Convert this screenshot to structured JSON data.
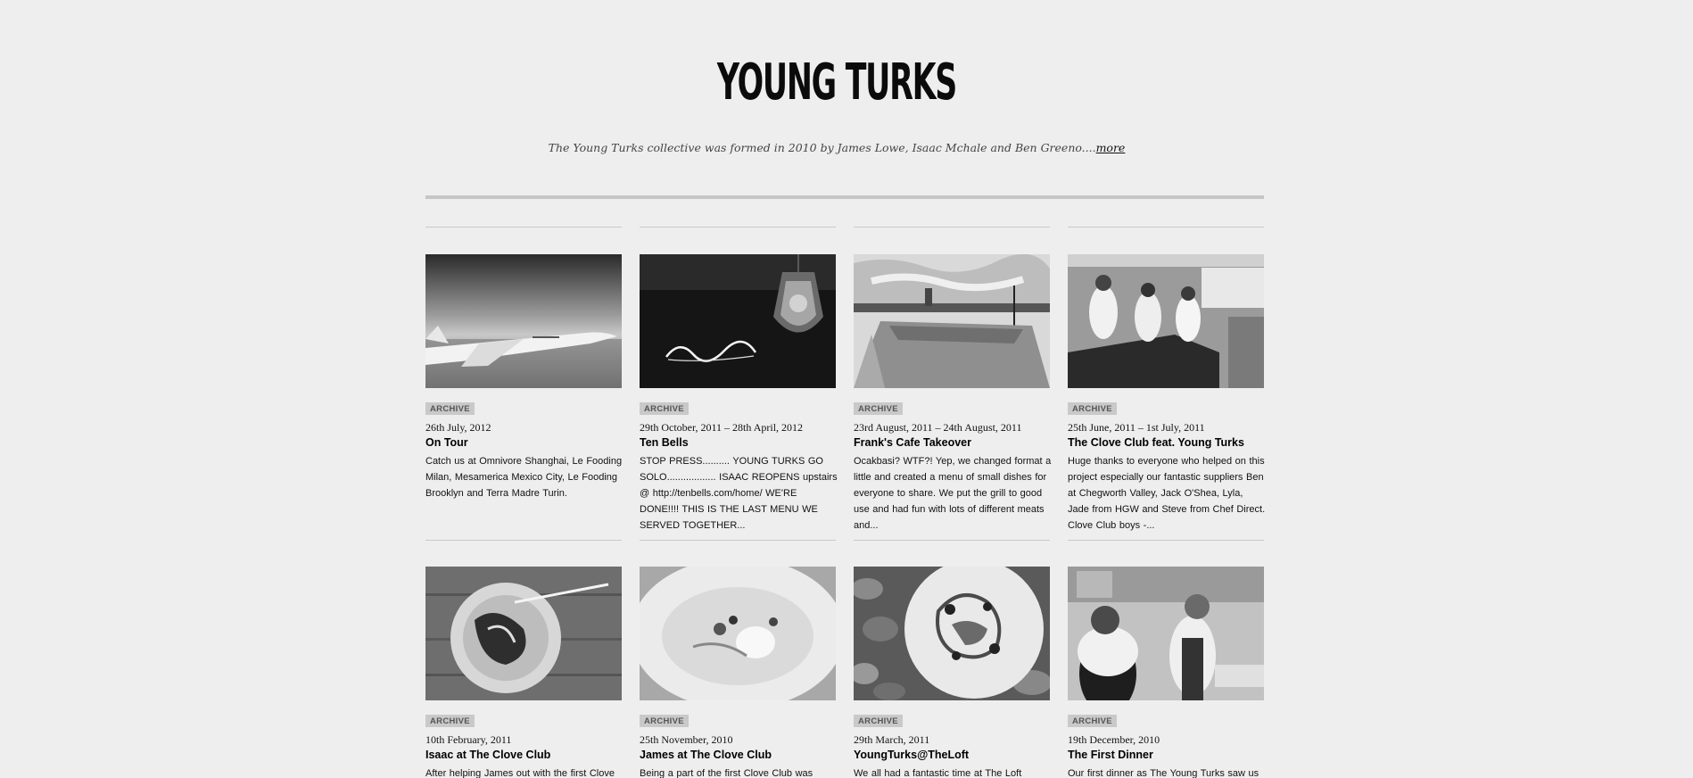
{
  "site": {
    "title": "YOUNG TURKS",
    "tagline": "The Young Turks collective was formed in 2010 by James Lowe, Isaac Mchale and Ben Greeno....",
    "more_link": "more"
  },
  "posts": [
    {
      "category": "ARCHIVE",
      "date": "26th July, 2012",
      "title": "On Tour",
      "excerpt": "Catch us at Omnivore Shanghai, Le Fooding Milan, Mesamerica Mexico City, Le Fooding Brooklyn and Terra Madre Turin.",
      "image": "concorde-plane-image"
    },
    {
      "category": "ARCHIVE",
      "date": "29th October, 2011 – 28th April, 2012",
      "title": "Ten Bells",
      "excerpt": "STOP PRESS.......... YOUNG TURKS GO SOLO.................. ISAAC REOPENS upstairs @ http://tenbells.com/home/ WE'RE DONE!!!! THIS IS THE LAST MENU WE SERVED TOGETHER...",
      "image": "chandelier-neon-image"
    },
    {
      "category": "ARCHIVE",
      "date": "23rd August, 2011 – 24th August, 2011",
      "title": "Frank's Cafe Takeover",
      "excerpt": "Ocakbasi? WTF?! Yep, we changed format a little and created a menu of small dishes for everyone to share. We put the grill to good use and had fun with lots of different meats and...",
      "image": "rooftop-skyline-image"
    },
    {
      "category": "ARCHIVE",
      "date": "25th June, 2011 – 1st July, 2011",
      "title": "The Clove Club feat. Young Turks",
      "excerpt": "Huge thanks to everyone who helped on this project especially our fantastic suppliers Ben at Chegworth Valley, Jack O'Shea, Lyla, Jade from HGW and Steve from Chef Direct. Clove Club boys -...",
      "image": "chefs-kitchen-image"
    },
    {
      "category": "ARCHIVE",
      "date": "10th February, 2011",
      "title": "Isaac at The Clove Club",
      "excerpt": "After helping James out with the first Clove",
      "image": "plate-fork-image"
    },
    {
      "category": "ARCHIVE",
      "date": "25th November, 2010",
      "title": "James at The Clove Club",
      "excerpt": "Being a part of the first Clove Club was really",
      "image": "plated-dish-image"
    },
    {
      "category": "ARCHIVE",
      "date": "29th March, 2011",
      "title": "YoungTurks@TheLoft",
      "excerpt": "We all had a fantastic time at The Loft",
      "image": "plate-on-stones-image"
    },
    {
      "category": "ARCHIVE",
      "date": "19th December, 2010",
      "title": "The First Dinner",
      "excerpt": "Our first dinner as The Young Turks saw us",
      "image": "chefs-cooking-image"
    }
  ]
}
